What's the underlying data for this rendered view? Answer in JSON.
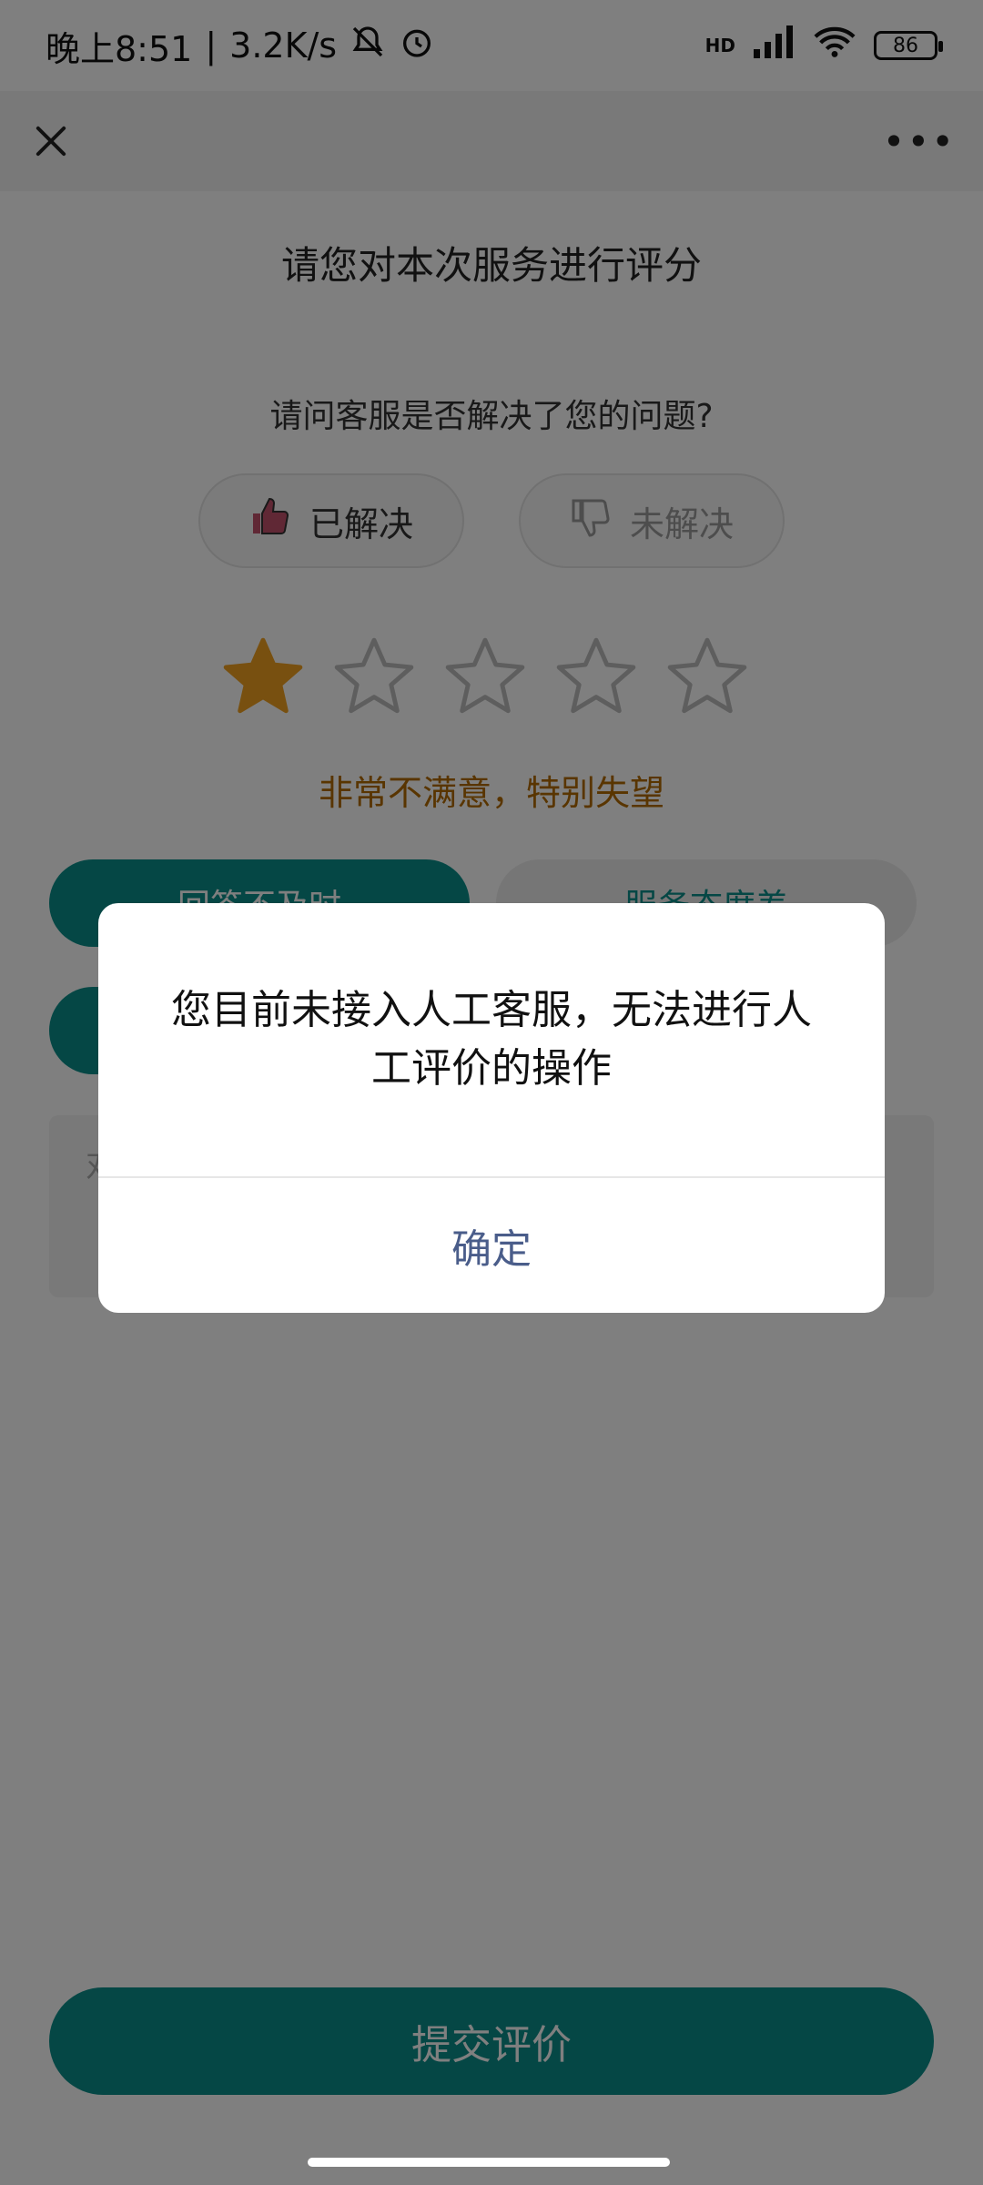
{
  "status_bar": {
    "time": "晚上8:51",
    "separator": "|",
    "speed": "3.2K/s",
    "network_label": "HD",
    "battery": "86"
  },
  "header": {
    "close_icon": "close-icon",
    "more_icon": "more-icon"
  },
  "page": {
    "title": "请您对本次服务进行评分",
    "question": "请问客服是否解决了您的问题?",
    "resolved_label": "已解决",
    "unresolved_label": "未解决",
    "rating": 1,
    "rating_max": 5,
    "rating_text": "非常不满意，特别失望",
    "tags": [
      "回答不及时",
      "服务态度差",
      ""
    ],
    "comment_placeholder": "对",
    "submit_label": "提交评价"
  },
  "dialog": {
    "message": "您目前未接入人工客服，无法进行人工评价的操作",
    "confirm_label": "确定"
  },
  "colors": {
    "accent": "#0a8f8a",
    "star_filled": "#f0a020",
    "rating_text": "#b36a00",
    "dialog_button": "#4a5d8a"
  }
}
